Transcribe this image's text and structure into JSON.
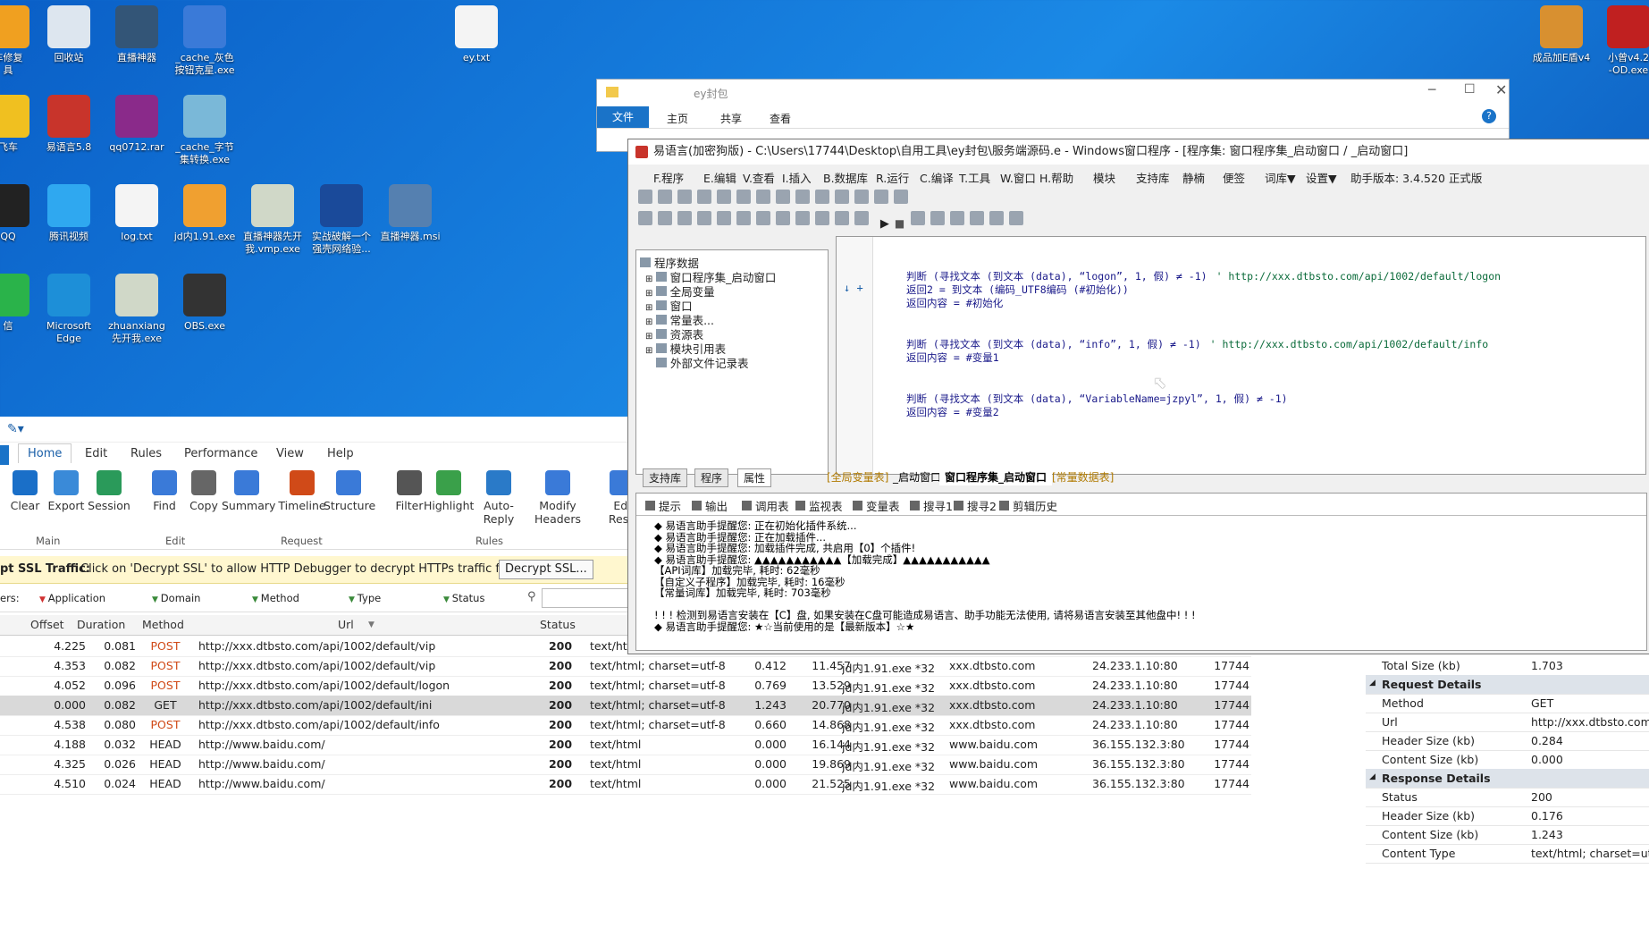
{
  "desktop": {
    "icons": [
      {
        "label": "车修复\n具",
        "color": "#f0a020"
      },
      {
        "label": "回收站",
        "color": "#dde6ef"
      },
      {
        "label": "直播神器",
        "color": "#335577"
      },
      {
        "label": "_cache_灰色\n按钮克星.exe",
        "color": "#3a7ad8"
      },
      {
        "label": "ey.txt",
        "color": "#f4f4f4"
      },
      {
        "label": "飞车",
        "color": "#f0c020"
      },
      {
        "label": "易语言5.8",
        "color": "#c8342b"
      },
      {
        "label": "qq0712.rar",
        "color": "#8a2a8a"
      },
      {
        "label": "_cache_字节\n集转换.exe",
        "color": "#7ab8d8"
      },
      {
        "label": "QQ",
        "color": "#222"
      },
      {
        "label": "腾讯视频",
        "color": "#2fa8f0"
      },
      {
        "label": "log.txt",
        "color": "#f4f4f4"
      },
      {
        "label": "jd内1.91.exe",
        "color": "#f0a030"
      },
      {
        "label": "直播神器先开\n我.vmp.exe",
        "color": "#d0d8c8"
      },
      {
        "label": "实战破解一个\n强壳网络验...",
        "color": "#1a4a9a"
      },
      {
        "label": "直播神器.msi",
        "color": "#5580b0"
      },
      {
        "label": "信",
        "color": "#2ab34a"
      },
      {
        "label": "Microsoft\nEdge",
        "color": "#1d8fd8"
      },
      {
        "label": "zhuanxiang\n先开我.exe",
        "color": "#d0d8c8"
      },
      {
        "label": "OBS.exe",
        "color": "#333"
      },
      {
        "label": "成品加E盾v4",
        "color": "#d89030"
      },
      {
        "label": "小曾v4.2\n-OD.exe",
        "color": "#c02020"
      }
    ]
  },
  "explorer": {
    "title": "ey封包",
    "tabs": [
      "文件",
      "主页",
      "共享",
      "查看"
    ]
  },
  "ide": {
    "title": "易语言(加密狗版) - C:\\Users\\17744\\Desktop\\自用工具\\ey封包\\服务端源码.e - Windows窗口程序 - [程序集: 窗口程序集_启动窗口 / _启动窗口]",
    "menu": [
      "F.程序",
      "E.编辑",
      "V.查看",
      "I.插入",
      "B.数据库",
      "R.运行",
      "C.编译",
      "T.工具",
      "W.窗口",
      "H.帮助",
      "模块",
      "支持库",
      "静楠",
      "便签",
      "词库▼",
      "设置▼",
      "助手版本: 3.4.520 正式版"
    ],
    "tree": [
      "程序数据",
      "窗口程序集_启动窗口",
      "全局变量",
      "窗口",
      "常量表...",
      "资源表",
      "模块引用表",
      "外部文件记录表"
    ],
    "code": [
      {
        "text": "判断 (寻找文本 (到文本 (data), “logon”, 1, 假) ≠ -1)",
        "comment": "' http://xxx.dtbsto.com/api/1002/default/logon"
      },
      {
        "text": "返回2 = 到文本 (编码_UTF8编码 (#初始化))",
        "comment": ""
      },
      {
        "text": "返回内容 = #初始化",
        "comment": ""
      },
      {
        "text": "判断 (寻找文本 (到文本 (data), “info”, 1, 假) ≠ -1)",
        "comment": "' http://xxx.dtbsto.com/api/1002/default/info"
      },
      {
        "text": "返回内容 = #变量1",
        "comment": ""
      },
      {
        "text": "判断 (寻找文本 (到文本 (data), “VariableName=jzpyl”, 1, 假) ≠ -1)",
        "comment": ""
      },
      {
        "text": "返回内容 = #变量2",
        "comment": ""
      }
    ],
    "left_tabs": [
      "支持库",
      "程序",
      "属性"
    ],
    "editor_tabs": [
      "[全局变量表]",
      "_启动窗口",
      "窗口程序集_启动窗口",
      "[常量数据表]"
    ],
    "output_tabs": [
      "提示",
      "输出",
      "调用表",
      "监视表",
      "变量表",
      "搜寻1",
      "搜寻2",
      "剪辑历史"
    ],
    "output_lines": [
      "◆ 易语言助手提醒您: 正在初始化插件系统...",
      "◆ 易语言助手提醒您: 正在加载插件...",
      "◆ 易语言助手提醒您: 加载插件完成, 共启用【0】个插件!",
      "◆ 易语言助手提醒您: ▲▲▲▲▲▲▲▲▲▲▲【加载完成】▲▲▲▲▲▲▲▲▲▲▲",
      "【API词库】加载完毕, 耗时: 62毫秒",
      "【自定义子程序】加载完毕, 耗时: 16毫秒",
      "【常量词库】加载完毕, 耗时: 703毫秒",
      "",
      "! ! ! 检测到易语言安装在【C】盘, 如果安装在C盘可能造成易语言、助手功能无法使用, 请将易语言安装至其他盘中! ! !",
      "◆ 易语言助手提醒您: ★☆当前使用的是【最新版本】☆★"
    ]
  },
  "debugger": {
    "ribbon_tabs": [
      "Home",
      "Edit",
      "Rules",
      "Performance",
      "View",
      "Help"
    ],
    "buttons": [
      {
        "label": "Clear",
        "icon": "clear-icon"
      },
      {
        "label": "Export",
        "icon": "export-icon"
      },
      {
        "label": "Session",
        "icon": "session-icon"
      },
      {
        "label": "Find",
        "icon": "find-icon"
      },
      {
        "label": "Copy",
        "icon": "copy-icon"
      },
      {
        "label": "Summary",
        "icon": "summary-icon"
      },
      {
        "label": "Timeline",
        "icon": "timeline-icon"
      },
      {
        "label": "Structure",
        "icon": "structure-icon"
      },
      {
        "label": "Filter",
        "icon": "filter-icon"
      },
      {
        "label": "Highlight",
        "icon": "highlight-icon"
      },
      {
        "label": "Auto-Reply",
        "icon": "auto-reply-icon"
      },
      {
        "label": "Modify\nHeaders",
        "icon": "modify-headers-icon"
      },
      {
        "label": "Edi\nResu",
        "icon": "edit-icon"
      }
    ],
    "groups": [
      "Main",
      "Edit",
      "Request",
      "Rules"
    ],
    "notice": {
      "bold": "pt SSL Traffic:",
      "text": "Click on 'Decrypt SSL' to allow HTTP Debugger to decrypt HTTPs traffic for you.",
      "button": "Decrypt SSL..."
    },
    "filters": {
      "label": "ers:",
      "items": [
        "Application",
        "Domain",
        "Method",
        "Type",
        "Status"
      ]
    },
    "columns": [
      "Offset",
      "Duration",
      "Method",
      "Url",
      "Status"
    ],
    "rows": [
      {
        "offset": "4.225",
        "duration": "0.081",
        "method": "POST",
        "url": "http://xxx.dtbsto.com/api/1002/default/vip",
        "status": "200",
        "type": "text/ht",
        "size": "",
        "time": "",
        "process": "",
        "host": "",
        "ip": "",
        "pid": ""
      },
      {
        "offset": "4.353",
        "duration": "0.082",
        "method": "POST",
        "url": "http://xxx.dtbsto.com/api/1002/default/vip",
        "status": "200",
        "type": "text/html; charset=utf-8",
        "size": "0.412",
        "time": "11.457",
        "process": "jd内1.91.exe *32",
        "host": "xxx.dtbsto.com",
        "ip": "24.233.1.10:80",
        "pid": "17744"
      },
      {
        "offset": "4.052",
        "duration": "0.096",
        "method": "POST",
        "url": "http://xxx.dtbsto.com/api/1002/default/logon",
        "status": "200",
        "type": "text/html; charset=utf-8",
        "size": "0.769",
        "time": "13.529",
        "process": "jd内1.91.exe *32",
        "host": "xxx.dtbsto.com",
        "ip": "24.233.1.10:80",
        "pid": "17744"
      },
      {
        "offset": "0.000",
        "duration": "0.082",
        "method": "GET",
        "url": "http://xxx.dtbsto.com/api/1002/default/ini",
        "status": "200",
        "type": "text/html; charset=utf-8",
        "size": "1.243",
        "time": "20.770",
        "process": "jd内1.91.exe *32",
        "host": "xxx.dtbsto.com",
        "ip": "24.233.1.10:80",
        "pid": "17744"
      },
      {
        "offset": "4.538",
        "duration": "0.080",
        "method": "POST",
        "url": "http://xxx.dtbsto.com/api/1002/default/info",
        "status": "200",
        "type": "text/html; charset=utf-8",
        "size": "0.660",
        "time": "14.868",
        "process": "jd内1.91.exe *32",
        "host": "xxx.dtbsto.com",
        "ip": "24.233.1.10:80",
        "pid": "17744"
      },
      {
        "offset": "4.188",
        "duration": "0.032",
        "method": "HEAD",
        "url": "http://www.baidu.com/",
        "status": "200",
        "type": "text/html",
        "size": "0.000",
        "time": "16.144",
        "process": "jd内1.91.exe *32",
        "host": "www.baidu.com",
        "ip": "36.155.132.3:80",
        "pid": "17744"
      },
      {
        "offset": "4.325",
        "duration": "0.026",
        "method": "HEAD",
        "url": "http://www.baidu.com/",
        "status": "200",
        "type": "text/html",
        "size": "0.000",
        "time": "19.869",
        "process": "jd内1.91.exe *32",
        "host": "www.baidu.com",
        "ip": "36.155.132.3:80",
        "pid": "17744"
      },
      {
        "offset": "4.510",
        "duration": "0.024",
        "method": "HEAD",
        "url": "http://www.baidu.com/",
        "status": "200",
        "type": "text/html",
        "size": "0.000",
        "time": "21.525",
        "process": "jd内1.91.exe *32",
        "host": "www.baidu.com",
        "ip": "36.155.132.3:80",
        "pid": "17744"
      }
    ],
    "selected_row": 3,
    "details": [
      {
        "kind": "row",
        "key": "Total Size (kb)",
        "value": "1.703"
      },
      {
        "kind": "header",
        "key": "Request Details",
        "value": ""
      },
      {
        "kind": "row",
        "key": "Method",
        "value": "GET"
      },
      {
        "kind": "row",
        "key": "Url",
        "value": "http://xxx.dtbsto.com/a"
      },
      {
        "kind": "row",
        "key": "Header Size (kb)",
        "value": "0.284"
      },
      {
        "kind": "row",
        "key": "Content Size (kb)",
        "value": "0.000"
      },
      {
        "kind": "header",
        "key": "Response Details",
        "value": ""
      },
      {
        "kind": "row",
        "key": "Status",
        "value": "200"
      },
      {
        "kind": "row",
        "key": "Header Size (kb)",
        "value": "0.176"
      },
      {
        "kind": "row",
        "key": "Content Size (kb)",
        "value": "1.243"
      },
      {
        "kind": "row",
        "key": "Content Type",
        "value": "text/html; charset=utf-8"
      }
    ]
  },
  "colors": {
    "post": "#d04a18",
    "accent": "#1a73c8",
    "selected": "#d9d9d9"
  }
}
